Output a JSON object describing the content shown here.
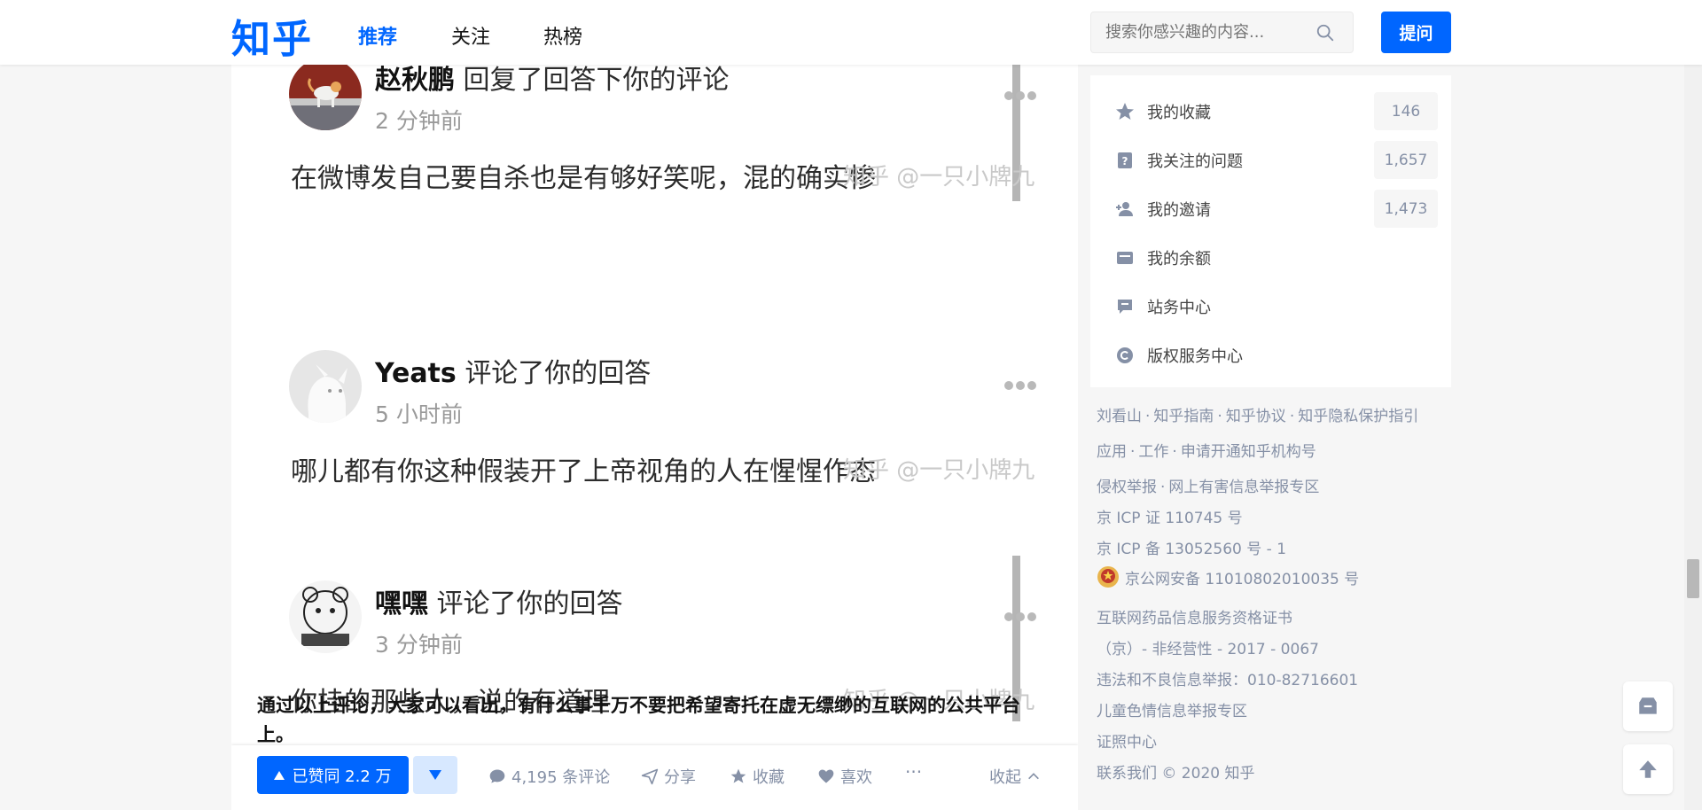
{
  "header": {
    "logo": "知乎",
    "tabs": [
      {
        "label": "推荐",
        "active": true
      },
      {
        "label": "关注",
        "active": false
      },
      {
        "label": "热榜",
        "active": false
      }
    ],
    "search_placeholder": "搜索你感兴趣的内容...",
    "ask_label": "提问"
  },
  "notifications": [
    {
      "user": "赵秋鹏",
      "action": "回复了回答下你的评论",
      "time": "2 分钟前",
      "body": "在微博发自己要自杀也是有够好笑呢，混的确实惨",
      "watermark": "知乎 @一只小牌九",
      "avatar_icon": "cat-photo-avatar"
    },
    {
      "user": "Yeats",
      "action": "评论了你的回答",
      "time": "5 小时前",
      "body": "哪儿都有你这种假装开了上帝视角的人在惺惺作态",
      "watermark": "知乎 @一只小牌九",
      "avatar_icon": "dog-cartoon-avatar"
    },
    {
      "user": "嘿嘿",
      "action": "评论了你的回答",
      "time": "3 分钟前",
      "body": "你挂的那些人，说的有道理",
      "watermark": "知乎 @一只小牌九",
      "avatar_icon": "sketch-avatar"
    }
  ],
  "conclusion": "通过以上评论，大家可以看出，有什么事千万不要把希望寄托在虚无缥缈的互联网的公共平台上。",
  "actions": {
    "vote_label": "已赞同 2.2 万",
    "comments": "4,195 条评论",
    "share": "分享",
    "favorite": "收藏",
    "like": "喜欢",
    "more": "···",
    "collapse": "收起"
  },
  "sidebar": {
    "items": [
      {
        "label": "我的收藏",
        "count": "146",
        "icon": "star-icon"
      },
      {
        "label": "我关注的问题",
        "count": "1,657",
        "icon": "question-icon"
      },
      {
        "label": "我的邀请",
        "count": "1,473",
        "icon": "invite-icon"
      },
      {
        "label": "我的余额",
        "count": "",
        "icon": "wallet-icon"
      },
      {
        "label": "站务中心",
        "count": "",
        "icon": "message-icon"
      },
      {
        "label": "版权服务中心",
        "count": "",
        "icon": "copyright-icon"
      }
    ]
  },
  "footer": {
    "row1": [
      "刘看山",
      "知乎指南",
      "知乎协议",
      "知乎隐私保护指引"
    ],
    "row2": [
      "应用",
      "工作",
      "申请开通知乎机构号"
    ],
    "row3": [
      "侵权举报",
      "网上有害信息举报专区"
    ],
    "icp1": "京 ICP 证 110745 号",
    "icp2": "京 ICP 备 13052560 号 - 1",
    "police": "京公网安备 11010802010035 号",
    "drug1": "互联网药品信息服务资格证书",
    "drug2": "（京）- 非经营性 - 2017 - 0067",
    "report": "违法和不良信息举报：010-82716601",
    "child": "儿童色情信息举报专区",
    "license": "证照中心",
    "contact": "联系我们 © 2020 知乎"
  },
  "colors": {
    "brand": "#0066ff",
    "muted": "#8590a6",
    "background": "#f6f6f6"
  }
}
